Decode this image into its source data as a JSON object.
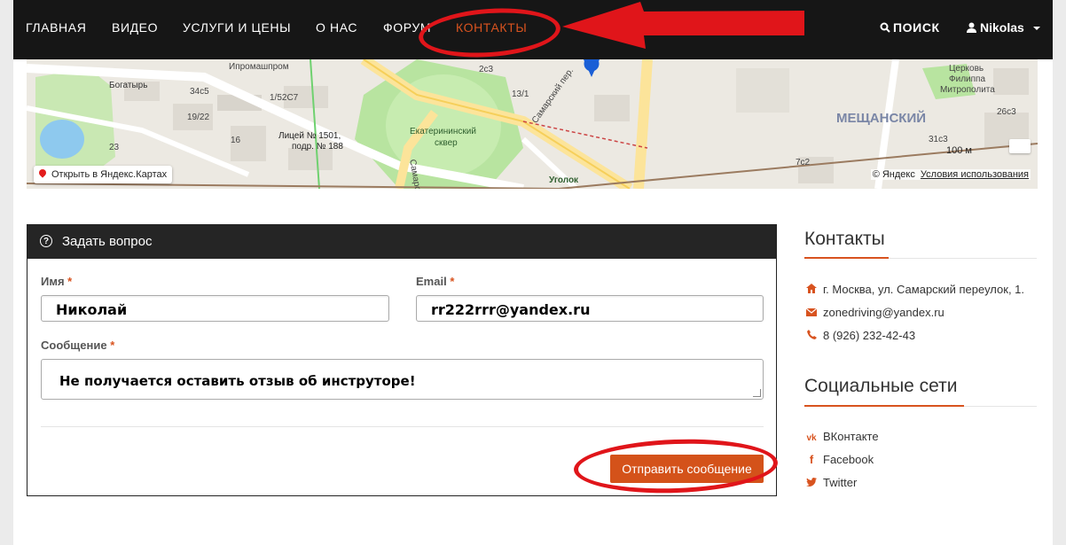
{
  "nav": {
    "items": [
      "ГЛАВНАЯ",
      "ВИДЕО",
      "УСЛУГИ И ЦЕНЫ",
      "О НАС",
      "ФОРУМ",
      "КОНТАКТЫ"
    ],
    "active": "КОНТАКТЫ",
    "search_label": "ПОИСК",
    "user_name": "Nikolas"
  },
  "map": {
    "labels": [
      "Ипромашпром",
      "Богатырь",
      "34c5",
      "19/22",
      "1/52С7",
      "16",
      "Лицей № 1501,",
      "подр. № 188",
      "23",
      "2с3",
      "13/1",
      "Самарский пер.",
      "Екатерининский",
      "сквер",
      "Уголок",
      "Самарск",
      "Церковь",
      "Филиппа",
      "Митрополита",
      "МЕЩАНСКИЙ",
      "31с3",
      "26с3",
      "7с2",
      "100 м"
    ],
    "open_label": "Открыть в Яндекс.Картах",
    "copyright": "© Яндекс",
    "terms": "Условия использования"
  },
  "form": {
    "title": "Задать вопрос",
    "name_label": "Имя",
    "name_value": "Николай",
    "email_label": "Email",
    "email_value": "rr222rrr@yandex.ru",
    "message_label": "Сообщение",
    "message_value": "Не получается оставить отзыв об инструторе!",
    "required_mark": "*",
    "submit_label": "Отправить сообщение"
  },
  "contacts": {
    "title": "Контакты",
    "address": "г. Москва, ул. Самарский переулок, 1.",
    "email": "zonedriving@yandex.ru",
    "phone": "8 (926) 232-42-43"
  },
  "social": {
    "title": "Социальные сети",
    "items": [
      "ВКонтакте",
      "Facebook",
      "Twitter"
    ]
  },
  "colors": {
    "accent": "#d8531f",
    "navbar": "#161616",
    "annotation": "#e0151a"
  }
}
